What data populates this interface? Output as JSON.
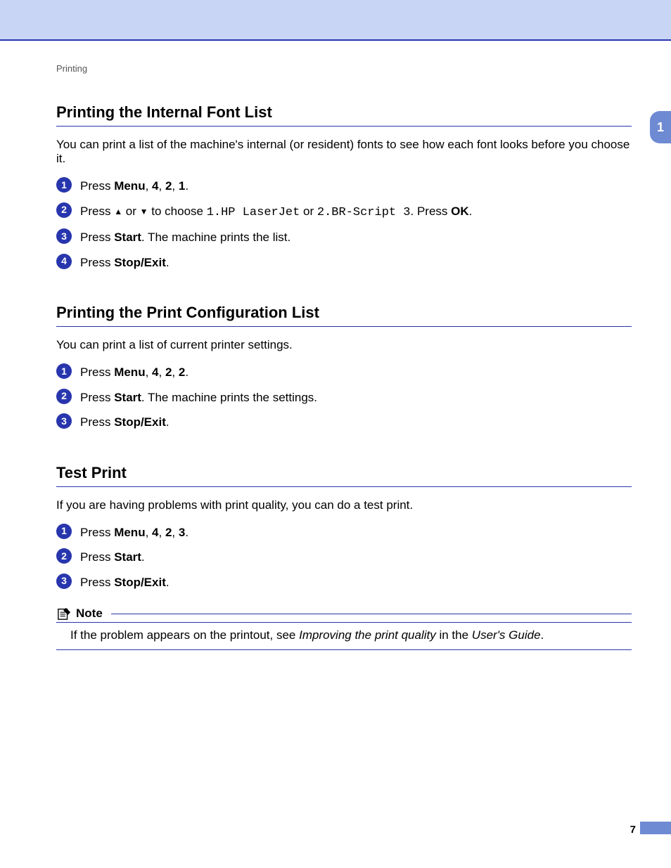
{
  "crumb": "Printing",
  "page_tab": "1",
  "page_number": "7",
  "sections": {
    "fontlist": {
      "title": "Printing the Internal Font List",
      "intro": "You can print a list of the machine's internal (or resident) fonts to see how each font looks before you choose it.",
      "s1_pre": "Press ",
      "s1_b1": "Menu",
      "s1_mid1": ", ",
      "s1_b2": "4",
      "s1_mid2": ", ",
      "s1_b3": "2",
      "s1_mid3": ", ",
      "s1_b4": "1",
      "s1_post": ".",
      "s2_pre": "Press ",
      "s2_mid1": " or ",
      "s2_mid2": " to choose ",
      "s2_c1": "1.HP LaserJet",
      "s2_or": " or ",
      "s2_c2": "2.BR-Script 3",
      "s2_dotpress": ". Press ",
      "s2_b1": "OK",
      "s2_post": ".",
      "s3_pre": "Press ",
      "s3_b1": "Start",
      "s3_post": ". The machine prints the list.",
      "s4_pre": "Press ",
      "s4_b1": "Stop/Exit",
      "s4_post": "."
    },
    "config": {
      "title": "Printing the Print Configuration List",
      "intro": "You can print a list of current printer settings.",
      "s1_pre": "Press ",
      "s1_b1": "Menu",
      "s1_mid1": ", ",
      "s1_b2": "4",
      "s1_mid2": ", ",
      "s1_b3": "2",
      "s1_mid3": ", ",
      "s1_b4": "2",
      "s1_post": ".",
      "s2_pre": "Press ",
      "s2_b1": "Start",
      "s2_post": ". The machine prints the settings.",
      "s3_pre": "Press ",
      "s3_b1": "Stop/Exit",
      "s3_post": "."
    },
    "test": {
      "title": "Test Print",
      "intro": "If you are having problems with print quality, you can do a test print.",
      "s1_pre": "Press ",
      "s1_b1": "Menu",
      "s1_mid1": ", ",
      "s1_b2": "4",
      "s1_mid2": ", ",
      "s1_b3": "2",
      "s1_mid3": ", ",
      "s1_b4": "3",
      "s1_post": ".",
      "s2_pre": "Press ",
      "s2_b1": "Start",
      "s2_post": ".",
      "s3_pre": "Press ",
      "s3_b1": "Stop/Exit",
      "s3_post": ".",
      "note_label": "Note",
      "note_pre": "If the problem appears on the printout, see ",
      "note_i1": "Improving the print quality",
      "note_mid": " in the ",
      "note_i2": "User's Guide",
      "note_post": "."
    }
  }
}
